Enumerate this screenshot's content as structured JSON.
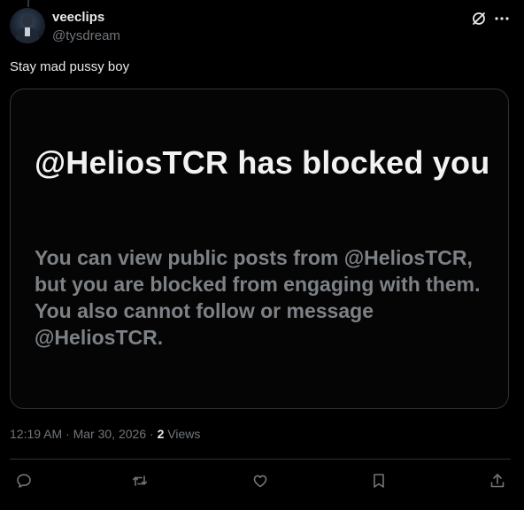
{
  "post": {
    "author": {
      "display_name": "veeclips",
      "handle": "@tysdream"
    },
    "text": "Stay mad pussy boy",
    "media": {
      "headline": "@HeliosTCR has blocked you",
      "body": "You can view public posts from @HeliosTCR, but you are blocked from engaging with them. You also cannot follow or message @HeliosTCR."
    },
    "meta": {
      "time": "12:19 AM",
      "separator1": " · ",
      "date": "Mar 30, 2026",
      "separator2": " · ",
      "views_count": "2",
      "views_label": " Views"
    }
  },
  "icons": {
    "header": [
      "grok-icon",
      "more-icon"
    ],
    "actions": [
      "reply-icon",
      "repost-icon",
      "like-icon",
      "bookmark-icon",
      "share-icon"
    ]
  },
  "colors": {
    "background": "#000000",
    "text_primary": "#e7e9ea",
    "text_secondary": "#71767b",
    "border": "#2f3336",
    "media_headline": "#f2f2f2",
    "media_body": "#7d8185"
  }
}
